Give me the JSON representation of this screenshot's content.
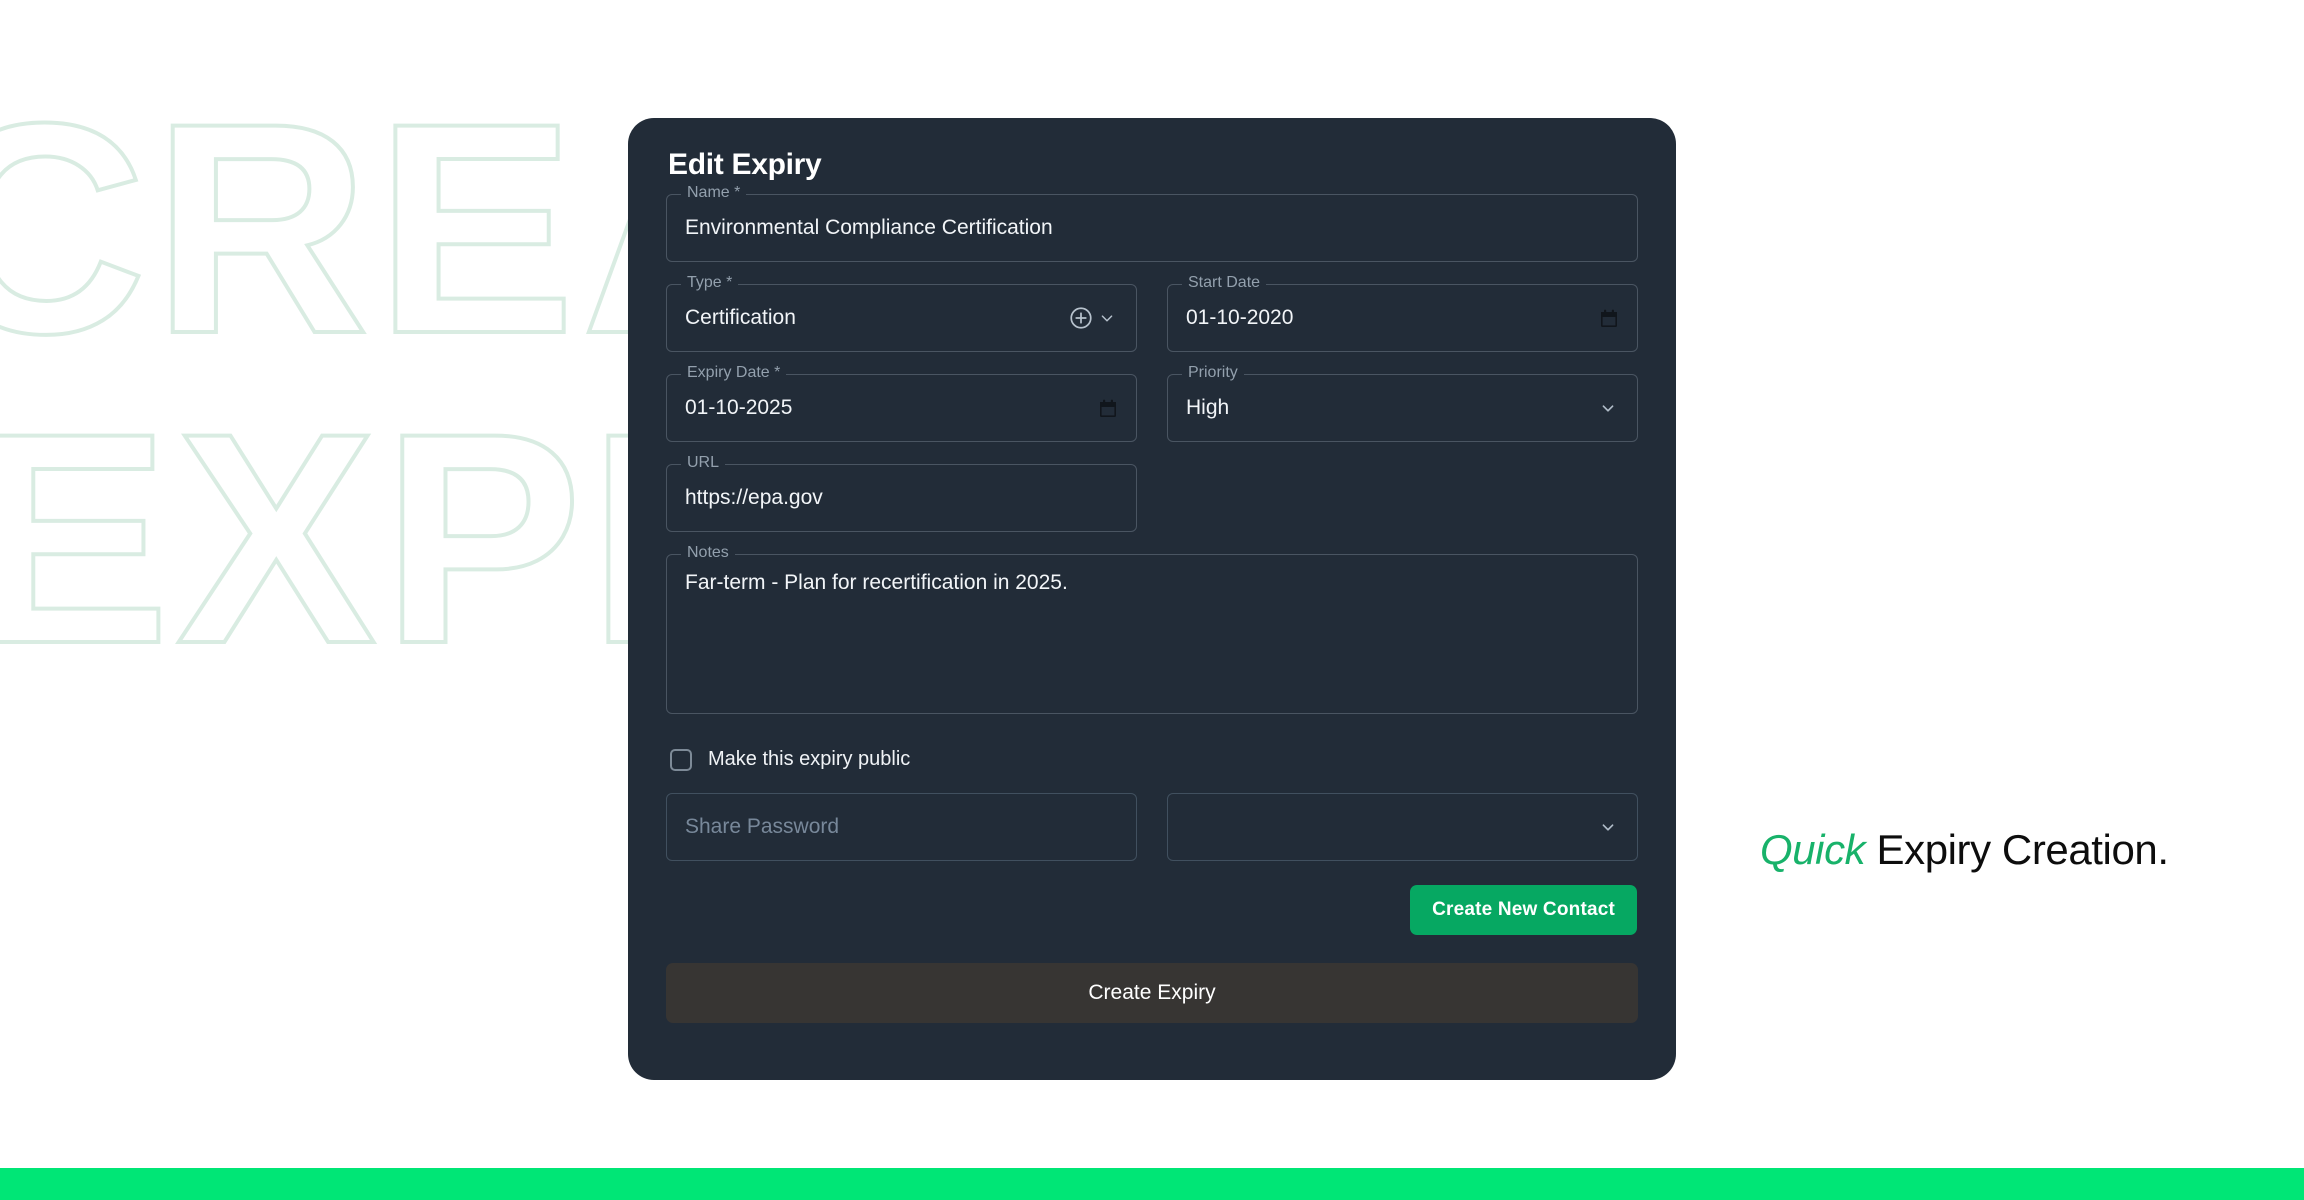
{
  "background": {
    "word_line_1": "CREATE",
    "word_line_2": "EXPIRY",
    "outline_color": "#d9ece2",
    "bottom_bar_color": "#00e676"
  },
  "tagline": {
    "accent_word": "Quick",
    "rest": " Expiry Creation.",
    "accent_color": "#18b26a",
    "text_color": "#0d0d0d"
  },
  "dialog": {
    "title": "Edit Expiry",
    "background_color": "#222c38",
    "fields": {
      "name": {
        "label": "Name *",
        "value": "Environmental Compliance Certification"
      },
      "type": {
        "label": "Type *",
        "value": "Certification",
        "icons": [
          "plus-circle-icon",
          "chevron-down-icon"
        ]
      },
      "start_date": {
        "label": "Start Date",
        "value": "01-10-2020",
        "icon": "calendar-icon"
      },
      "expiry_date": {
        "label": "Expiry Date *",
        "value": "01-10-2025",
        "icon": "calendar-icon"
      },
      "priority": {
        "label": "Priority",
        "value": "High",
        "icon": "chevron-down-icon"
      },
      "url": {
        "label": "URL",
        "value": "https://epa.gov"
      },
      "notes": {
        "label": "Notes",
        "value": "Far-term - Plan for recertification in 2025."
      },
      "share_password": {
        "placeholder": "Share Password",
        "value": ""
      },
      "contact_select": {
        "value": "",
        "icon": "chevron-down-icon"
      }
    },
    "checkbox": {
      "label": "Make this expiry public",
      "checked": false
    },
    "buttons": {
      "create_contact": "Create New Contact",
      "create_contact_color": "#06a862",
      "submit": "Create Expiry",
      "submit_color": "#373533"
    }
  }
}
